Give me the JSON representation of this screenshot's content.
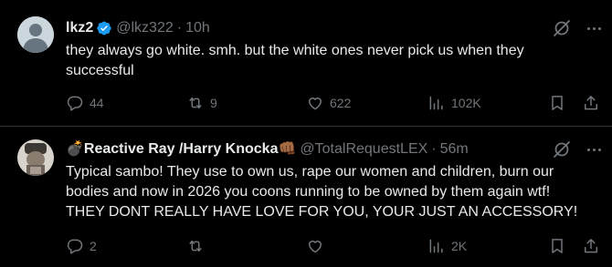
{
  "tweets": [
    {
      "display_name": "lkz2",
      "verified": true,
      "handle": "@lkz322",
      "separator": "·",
      "time": "10h",
      "text": "they always go white. smh. but the white ones never pick us when they\nsuccessful",
      "reply_count": "44",
      "repost_count": "9",
      "like_count": "622",
      "view_count": "102K"
    },
    {
      "name_prefix_emoji": "💣",
      "display_name": "Reactive Ray /Harry Knocka",
      "name_suffix_emoji": "👊🏾",
      "handle": "@TotalRequestLEX",
      "separator": "·",
      "time": "56m",
      "text": "Typical sambo! They use to own us, rape our women and children, burn our\nbodies and now in 2026 you coons running to be owned by them again wtf!\nTHEY DONT REALLY HAVE LOVE FOR YOU, YOUR JUST AN ACCESSORY!",
      "reply_count": "2",
      "repost_count": "",
      "like_count": "",
      "view_count": "2K"
    }
  ],
  "colors": {
    "background": "#000000",
    "primary_text": "#e7e9ea",
    "secondary_text": "#71767b",
    "verified_badge": "#1d9bf0",
    "divider": "#2f3336"
  },
  "icons": [
    "verified-badge-icon",
    "grok-icon",
    "more-icon",
    "reply-icon",
    "repost-icon",
    "like-icon",
    "views-icon",
    "bookmark-icon",
    "share-icon"
  ]
}
